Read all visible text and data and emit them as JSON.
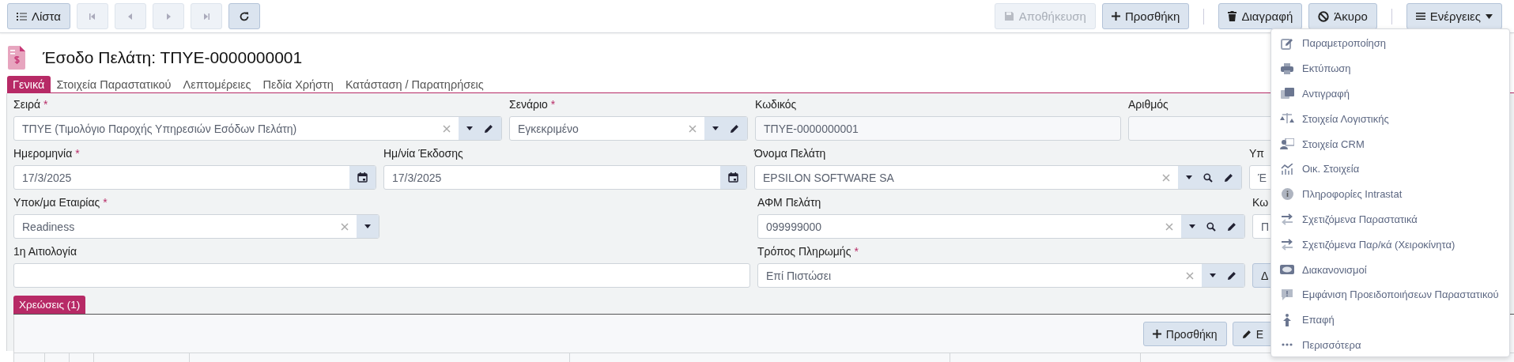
{
  "toolbar": {
    "left": [
      {
        "kind": "list",
        "label": "Λίστα",
        "disabled": false
      },
      {
        "kind": "first",
        "disabled": true
      },
      {
        "kind": "prev",
        "disabled": true
      },
      {
        "kind": "next",
        "disabled": true
      },
      {
        "kind": "last",
        "disabled": true
      },
      {
        "kind": "refresh",
        "disabled": false
      }
    ],
    "right": [
      {
        "kind": "save",
        "label": "Αποθήκευση",
        "disabled": true
      },
      {
        "kind": "add",
        "label": "Προσθήκη",
        "disabled": false
      },
      {
        "kind": "separator"
      },
      {
        "kind": "delete",
        "label": "Διαγραφή",
        "disabled": false
      },
      {
        "kind": "cancel",
        "label": "Άκυρο",
        "disabled": false
      },
      {
        "kind": "separator"
      },
      {
        "kind": "actions",
        "label": "Ενέργειες",
        "disabled": false,
        "expanded": true
      }
    ]
  },
  "title": "Έσοδο Πελάτη: ΤΠΥΕ-0000000001",
  "tabs": [
    {
      "label": "Γενικά",
      "selected": true
    },
    {
      "label": "Στοιχεία Παραστατικού",
      "selected": false
    },
    {
      "label": "Λεπτομέρειες",
      "selected": false
    },
    {
      "label": "Πεδία Χρήστη",
      "selected": false
    },
    {
      "label": "Κατάσταση / Παρατηρήσεις",
      "selected": false
    }
  ],
  "form_rows": [
    [
      {
        "kind": "select",
        "label": "Σειρά",
        "required_mark": "*",
        "value": "ΤΠΥΕ (Τιμολόγιο Παροχής Υπηρεσιών Εσόδων Πελάτη)",
        "searchable": false,
        "editable": true
      },
      {
        "kind": "select",
        "label": "Σενάριο",
        "required_mark": "*",
        "value": "Εγκεκριμένο",
        "searchable": false,
        "editable": true
      },
      {
        "kind": "readonly",
        "label": "Κωδικός",
        "value": "ΤΠΥΕ-0000000001"
      },
      {
        "kind": "readonly",
        "label": "Αριθμός"
      }
    ],
    [
      {
        "kind": "date",
        "label": "Ημερομηνία",
        "required_mark": "*",
        "value": "17/3/2025"
      },
      {
        "kind": "date",
        "label": "Ημ/νία Έκδοσης",
        "value": "17/3/2025"
      },
      {
        "kind": "select",
        "label": "Όνομα Πελάτη",
        "value": "EPSILON SOFTWARE SA",
        "searchable": true,
        "editable": true
      },
      {
        "kind": "text",
        "label": "Υπ",
        "value": "Έ"
      }
    ],
    [
      {
        "kind": "select",
        "label": "Υποκ/μα Εταιρίας",
        "required_mark": "*",
        "value": "Readiness",
        "searchable": false,
        "editable": false
      },
      {
        "kind": "blank"
      },
      {
        "kind": "select",
        "label": "ΑΦΜ Πελάτη",
        "value": "099999000",
        "searchable": true,
        "editable": true
      },
      {
        "kind": "text",
        "label": "Κω",
        "value": "Π"
      }
    ],
    [
      {
        "kind": "text",
        "label": "1η Αιτιολογία"
      },
      {
        "kind": "select",
        "label": "Τρόπος Πληρωμής",
        "required_mark": "*",
        "value": "Επί Πιστώσει",
        "searchable": false,
        "editable": true
      },
      {
        "kind": "button",
        "label": "Δ"
      }
    ]
  ],
  "subtabs": [
    {
      "label": "Χρεώσεις (1)",
      "selected": true
    }
  ],
  "grid_toolbar": [
    {
      "kind": "add",
      "label": "Προσθήκη"
    },
    {
      "kind": "edit",
      "label": "Ε"
    }
  ],
  "menu": {
    "items": [
      {
        "label": "Παραμετροποίηση"
      },
      {
        "label": "Εκτύπωση"
      },
      {
        "label": "Αντιγραφή"
      },
      {
        "label": "Στοιχεία Λογιστικής"
      },
      {
        "label": "Στοιχεία CRM"
      },
      {
        "label": "Οικ. Στοιχεία"
      },
      {
        "label": "Πληροφορίες Intrastat"
      },
      {
        "label": "Σχετιζόμενα Παραστατικά"
      },
      {
        "label": "Σχετιζόμενα Παρ/κά (Χειροκίνητα)"
      },
      {
        "label": "Διακανονισμοί"
      },
      {
        "label": "Εμφάνιση Προειδοποιήσεων Παραστατικού"
      },
      {
        "label": "Επαφή"
      },
      {
        "label": "Περισσότερα"
      }
    ]
  }
}
